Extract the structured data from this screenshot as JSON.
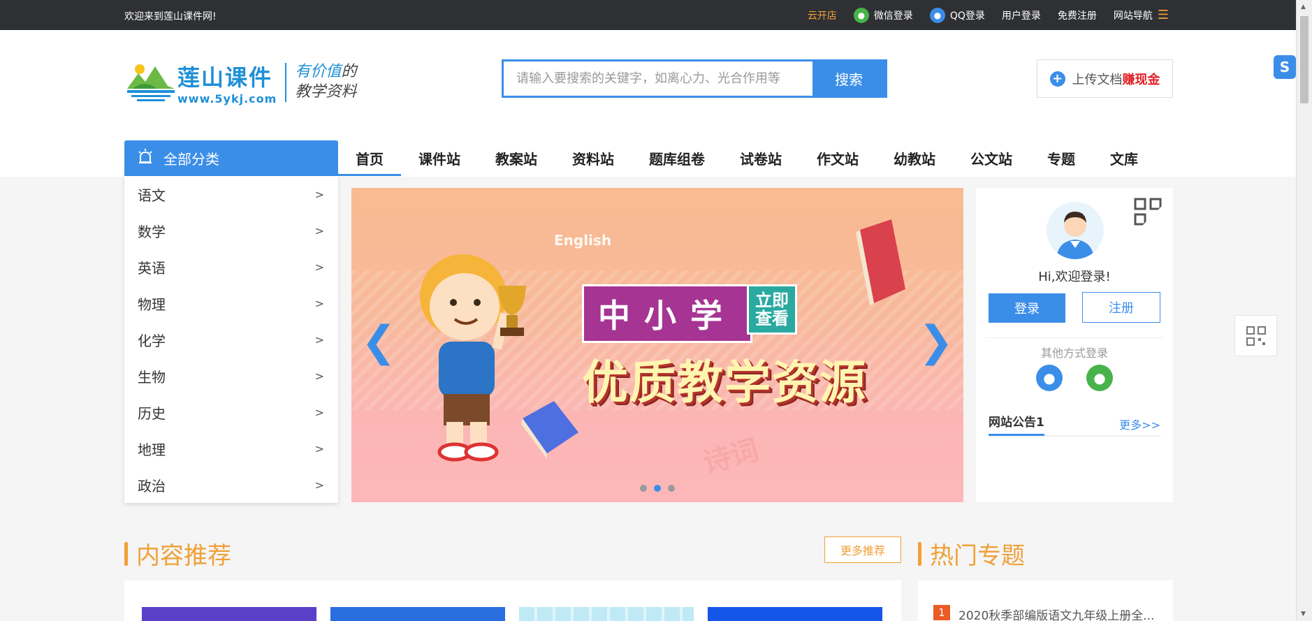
{
  "topbar": {
    "welcome": "欢迎来到莲山课件网!",
    "links": {
      "cloud_store": "云开店",
      "wechat_login": "微信登录",
      "qq_login": "QQ登录",
      "user_login": "用户登录",
      "register": "免费注册",
      "site_nav": "网站导航"
    }
  },
  "logo": {
    "title": "莲山课件",
    "url": "www.5ykj.com",
    "slogan_highlight": "有价值",
    "slogan_suffix": "的",
    "slogan_line2": "教学资料"
  },
  "search": {
    "placeholder": "请输入要搜索的关键字，如离心力、光合作用等",
    "button": "搜索"
  },
  "upload": {
    "label": "上传文档",
    "highlight": "赚现金"
  },
  "category_header": "全部分类",
  "nav": [
    "首页",
    "课件站",
    "教案站",
    "资料站",
    "题库组卷",
    "试卷站",
    "作文站",
    "幼教站",
    "公文站",
    "专题",
    "文库"
  ],
  "categories": [
    "语文",
    "数学",
    "英语",
    "物理",
    "化学",
    "生物",
    "历史",
    "地理",
    "政治"
  ],
  "category_arrow": ">",
  "banner": {
    "english": "English",
    "headline1": "中小学",
    "cta_line1": "立即",
    "cta_line2": "查看",
    "headline2": "优质教学资源",
    "poem": "诗词",
    "active_slide": 2,
    "slide_count": 3
  },
  "user_panel": {
    "greeting": "Hi,欢迎登录!",
    "login": "登录",
    "register": "注册",
    "other_methods": "其他方式登录",
    "notice_title": "网站公告1",
    "notice_more": "更多>>"
  },
  "sections": {
    "recommend_title": "内容推荐",
    "recommend_more": "更多推荐",
    "hot_title": "热门专题",
    "hot_items": [
      {
        "rank": "1",
        "text": "2020秋季部编版语文九年级上册全..."
      }
    ]
  },
  "colors": {
    "accent": "#3b8ee8",
    "orange": "#f0a038",
    "topbar": "#2f3033",
    "red": "#e21f26",
    "wechat_green": "#47b34a"
  }
}
